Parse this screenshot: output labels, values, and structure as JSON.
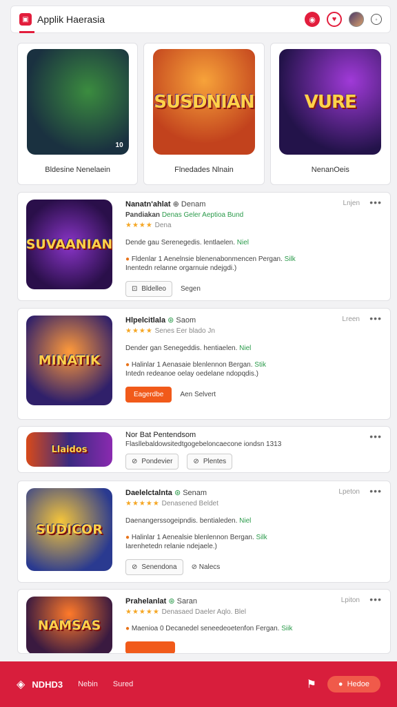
{
  "header": {
    "title": "Applik Haerasia",
    "logo_icon": "app-logo-icon",
    "icons": [
      "notification-icon",
      "heart-icon",
      "avatar",
      "settings-icon"
    ]
  },
  "featured": [
    {
      "label": "Bldesine Nenelaein",
      "art_text": "",
      "badge": "10"
    },
    {
      "label": "Flnedades Nlnain",
      "art_text": "SUSDNIAN",
      "badge": ""
    },
    {
      "label": "NenanOeis",
      "art_text": "VURE",
      "badge": ""
    }
  ],
  "apps": [
    {
      "name": "Nanatn'ahlat",
      "dev": "Denam",
      "sub": "Pandiakan",
      "sub_extra": "Denas Geler Aeptioa Bund",
      "stars": "★★★★",
      "rating_text": "Dena",
      "time": "Lnjen",
      "desc": "Dende gau Serenegedis. lentlaelen.",
      "desc_tag": "Niel",
      "feature": "Fldenlar 1 Aenelnsie blenenabonmencen Pergan.",
      "feature_tag": "Silk",
      "feature2": "Inentedn relanne orgarnuie ndejgdi.)",
      "btn1": "Bldelleo",
      "btn2": "Segen",
      "art": "SUVAANIAN"
    },
    {
      "name": "Hlpelcitlala",
      "dev": "Saom",
      "sub_extra": "Senes Eer blado Jn",
      "stars": "★★★★",
      "rating_text": "",
      "time": "Lreen",
      "desc": "Dender gan Senegeddis. hentiaelen.",
      "desc_tag": "Niel",
      "feature": "Halinlar 1 Aenasaie blenlennon Bergan.",
      "feature_tag": "Stik",
      "feature2": "Intedn redeanoe oelay oedelane ndopqdis.)",
      "btn1": "Eagerdbe",
      "btn2": "Aen Selvert",
      "art": "MINATIK"
    },
    {
      "name": "Nor Bat Pentendsom",
      "feature": "Flasllebaldowsitedtgogebeloncaecone iondsn 1313",
      "btn1": "Pondevier",
      "btn2": "Plentes",
      "art": "Llaidos"
    },
    {
      "name": "Daelelctalnta",
      "dev": "Senam",
      "sub_extra": "Denasened Beldet",
      "stars": "★★★★★",
      "time": "Lpeton",
      "desc": "Daenangerssogeipndis. bentialeden.",
      "desc_tag": "Niel",
      "feature": "Halinlar 1 Aenealsie blenlennon Bergan.",
      "feature_tag": "Silk",
      "feature2": "Iarenhetedn relanie ndejaele.)",
      "btn1": "Senendona",
      "btn2": "Nalecs",
      "art": "SUDICOR"
    },
    {
      "name": "Prahelanlat",
      "dev": "Saran",
      "sub_extra": "Denasaed Daeler Aqlo. Blel",
      "stars": "★★★★★",
      "time": "Lpiton",
      "feature": "Maenioa 0 Decanedel seneedeoetenfon Fergan.",
      "feature_tag": "Siik",
      "art": "NAMSAS"
    }
  ],
  "bottom_bar": {
    "brand": "NDHD3",
    "links": [
      "Nebin",
      "Sured"
    ],
    "cta": "Hedoe"
  },
  "colors": {
    "accent": "#d81e3c",
    "orange": "#f15a1a",
    "verified": "#2a9a4a",
    "star": "#f5a623"
  }
}
